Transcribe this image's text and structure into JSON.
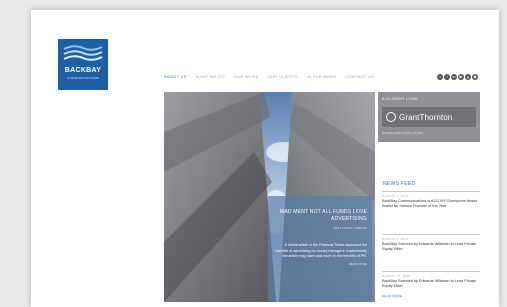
{
  "logo": {
    "name": "BACKBAY",
    "subtitle": "COMMUNICATIONS"
  },
  "nav": {
    "items": [
      "ABOUT US",
      "WHAT WE DO",
      "OUR WORK",
      "OUR CLIENTS",
      "IN THE NEWS",
      "CONTACT US"
    ],
    "active": "ABOUT US"
  },
  "social": [
    "twitter",
    "facebook",
    "linkedin",
    "youtube",
    "google-plus",
    "rss"
  ],
  "hero": {
    "title": "MAD MENT NOT ALL FUNDS LOVE ADVERTISING",
    "author": "MATT FOX/FT, LONDON",
    "body": "A recent article in the Financial Times discussed the benefits of advertising for money managers. Inadvertently the article may have cast more on the benefits of PR.",
    "more": "READ MORE"
  },
  "closer_look": {
    "heading": "A CLOSER LOOK",
    "brand": "GrantThornton",
    "footer": "DOWNLOAD CASE STUDY"
  },
  "news_feed": {
    "title": "NEWS FEED",
    "items": [
      {
        "date": "AUGUST 7, 2013",
        "text": "BackBay Communications is ACG NY Champions Award finalist for Service Provider of the Year"
      },
      {
        "date": "AUGUST 7, 2013",
        "text": "BackBay Selected by Edwards Wildman to Lead Private Equity Effort"
      },
      {
        "date": "AUGUST 17, 2013",
        "text": "BackBay Selected by Edwards Wildman to Lead Private Equity Effort"
      }
    ],
    "read_more": "READ MORE"
  },
  "colors": {
    "brand_blue": "#1f5fa6",
    "link_blue": "#2f6fb0",
    "panel_gray": "#8e9297"
  }
}
